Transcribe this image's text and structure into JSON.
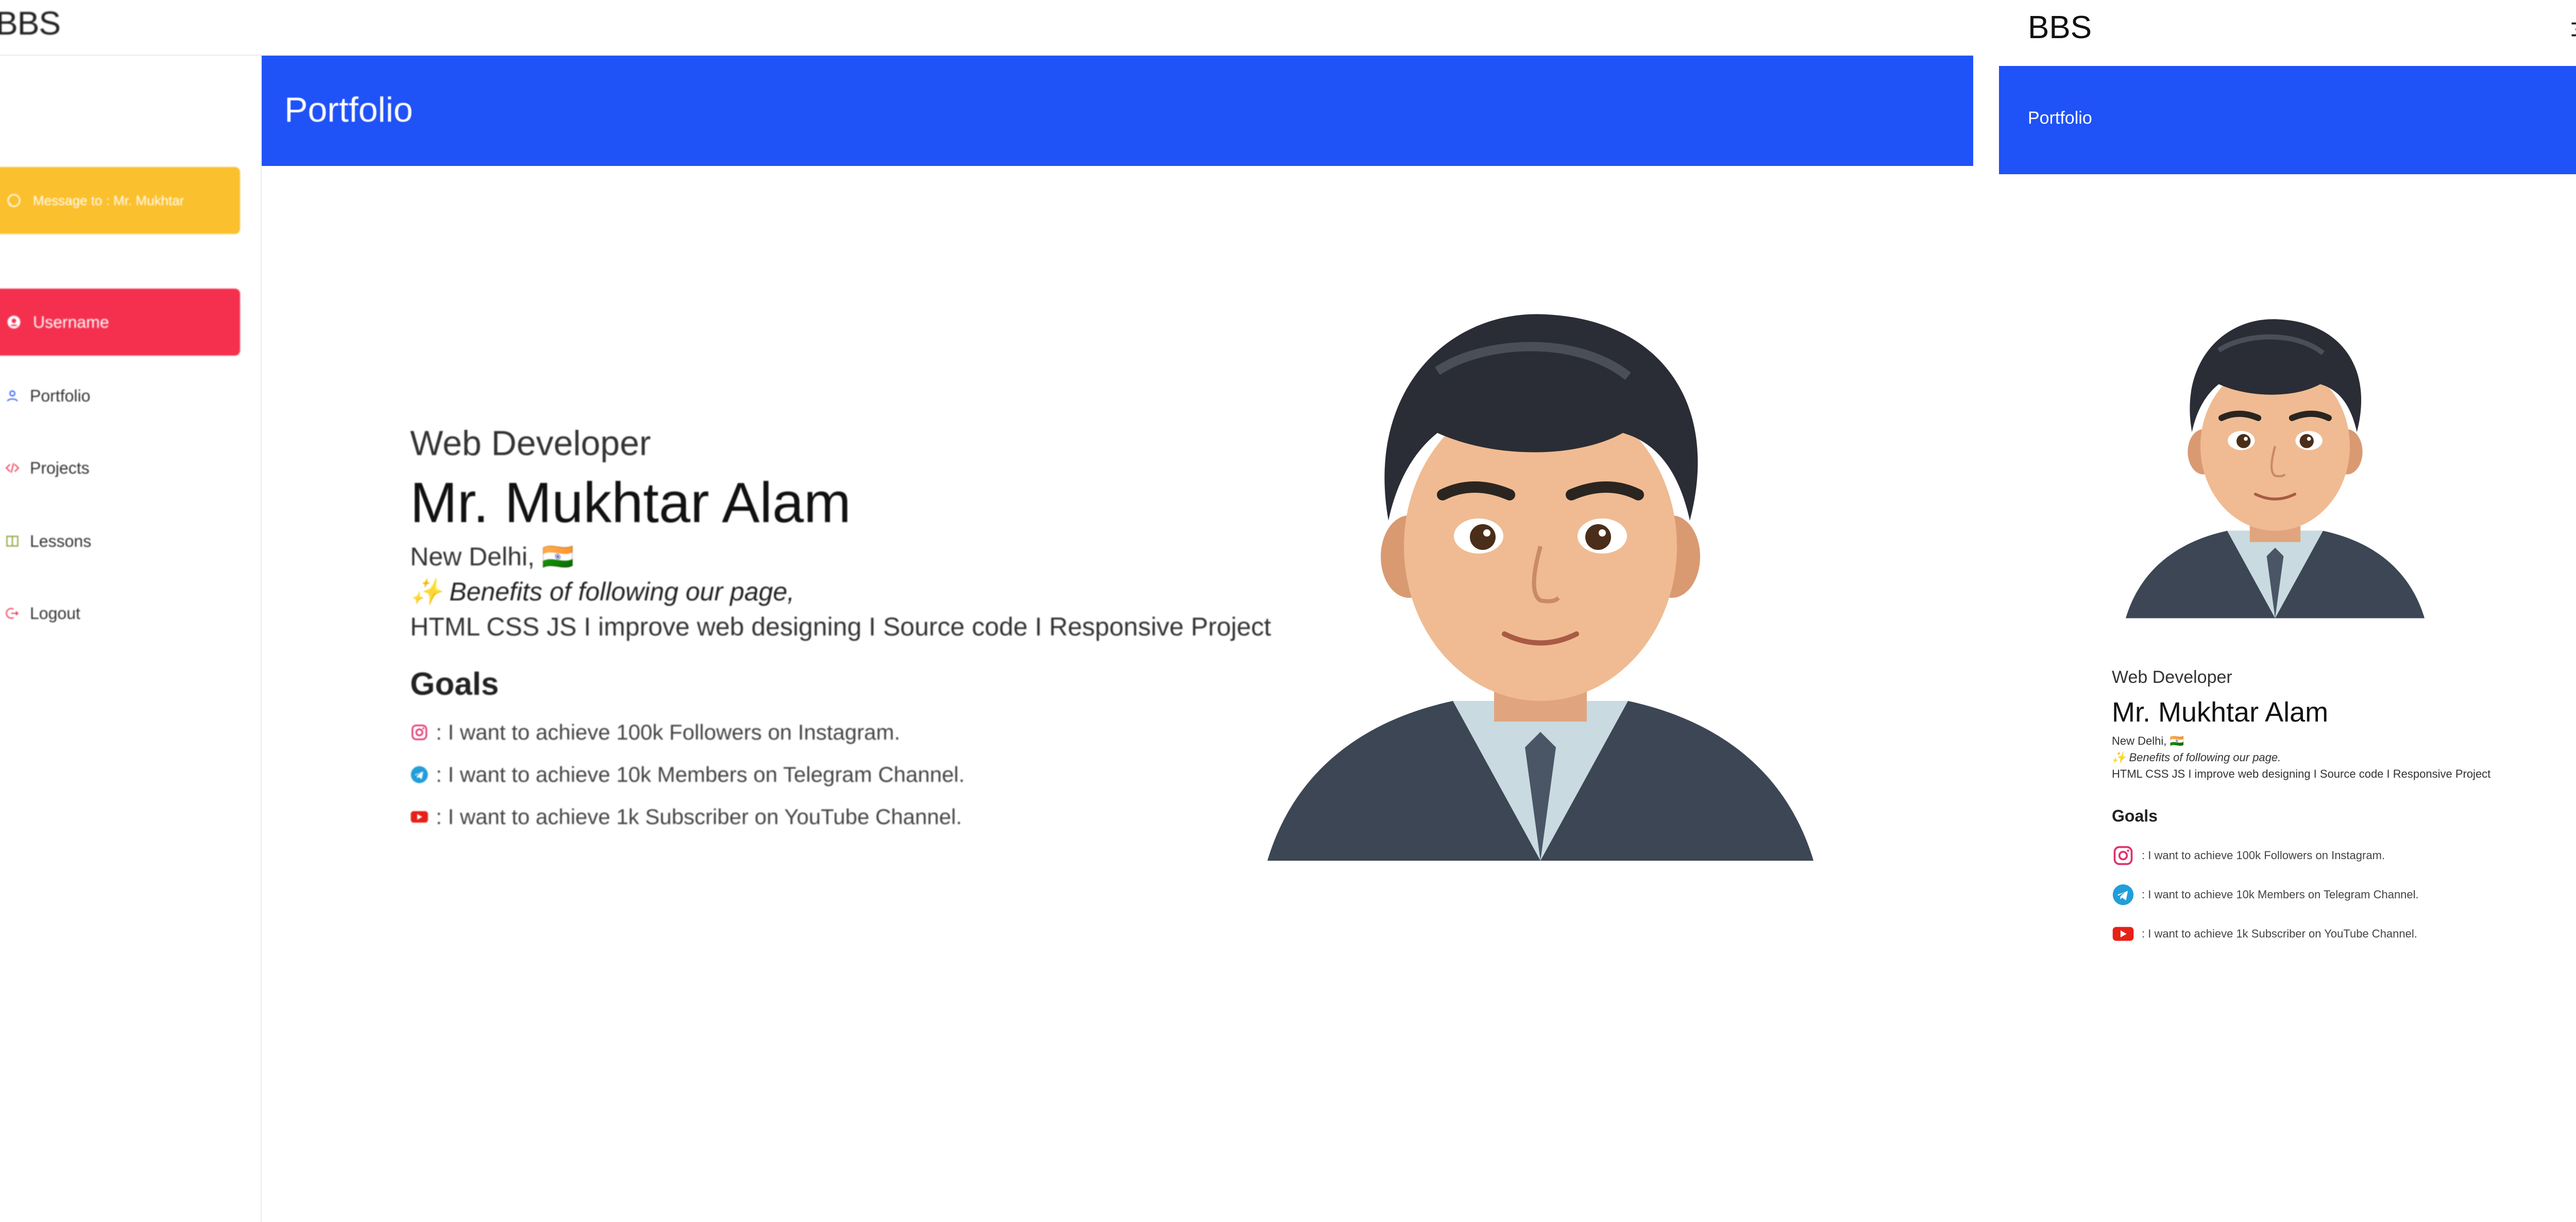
{
  "app": {
    "brand": "BBS"
  },
  "sidebar": {
    "message_button_label": "Message to : Mr. Mukhtar",
    "username_button_label": "Username",
    "items": [
      {
        "label": "Portfolio",
        "icon": "user-icon"
      },
      {
        "label": "Projects",
        "icon": "code-icon"
      },
      {
        "label": "Lessons",
        "icon": "book-icon"
      },
      {
        "label": "Logout",
        "icon": "logout-icon"
      }
    ]
  },
  "header": {
    "title": "Portfolio"
  },
  "profile": {
    "role": "Web Developer",
    "name": "Mr. Mukhtar Alam",
    "location": "New Delhi, 🇮🇳",
    "benefits": "✨ Benefits of following our page,",
    "benefits_mobile": "✨ Benefits of following our page.",
    "skills": "HTML CSS JS I improve web designing I Source code I Responsive Project"
  },
  "goals": {
    "title": "Goals",
    "items": [
      {
        "icon": "instagram-icon",
        "text": ": I want to achieve 100k Followers on Instagram."
      },
      {
        "icon": "telegram-icon",
        "text": ": I want to achieve 10k Members on Telegram Channel."
      },
      {
        "icon": "youtube-icon",
        "text": ": I want to achieve 1k Subscriber on YouTube Channel."
      }
    ]
  },
  "colors": {
    "header_blue": "#1f52f7",
    "message_yellow": "#fbc02d",
    "username_red": "#f5304f",
    "instagram": "#e1306c",
    "telegram": "#229ed9",
    "youtube": "#e62117"
  }
}
